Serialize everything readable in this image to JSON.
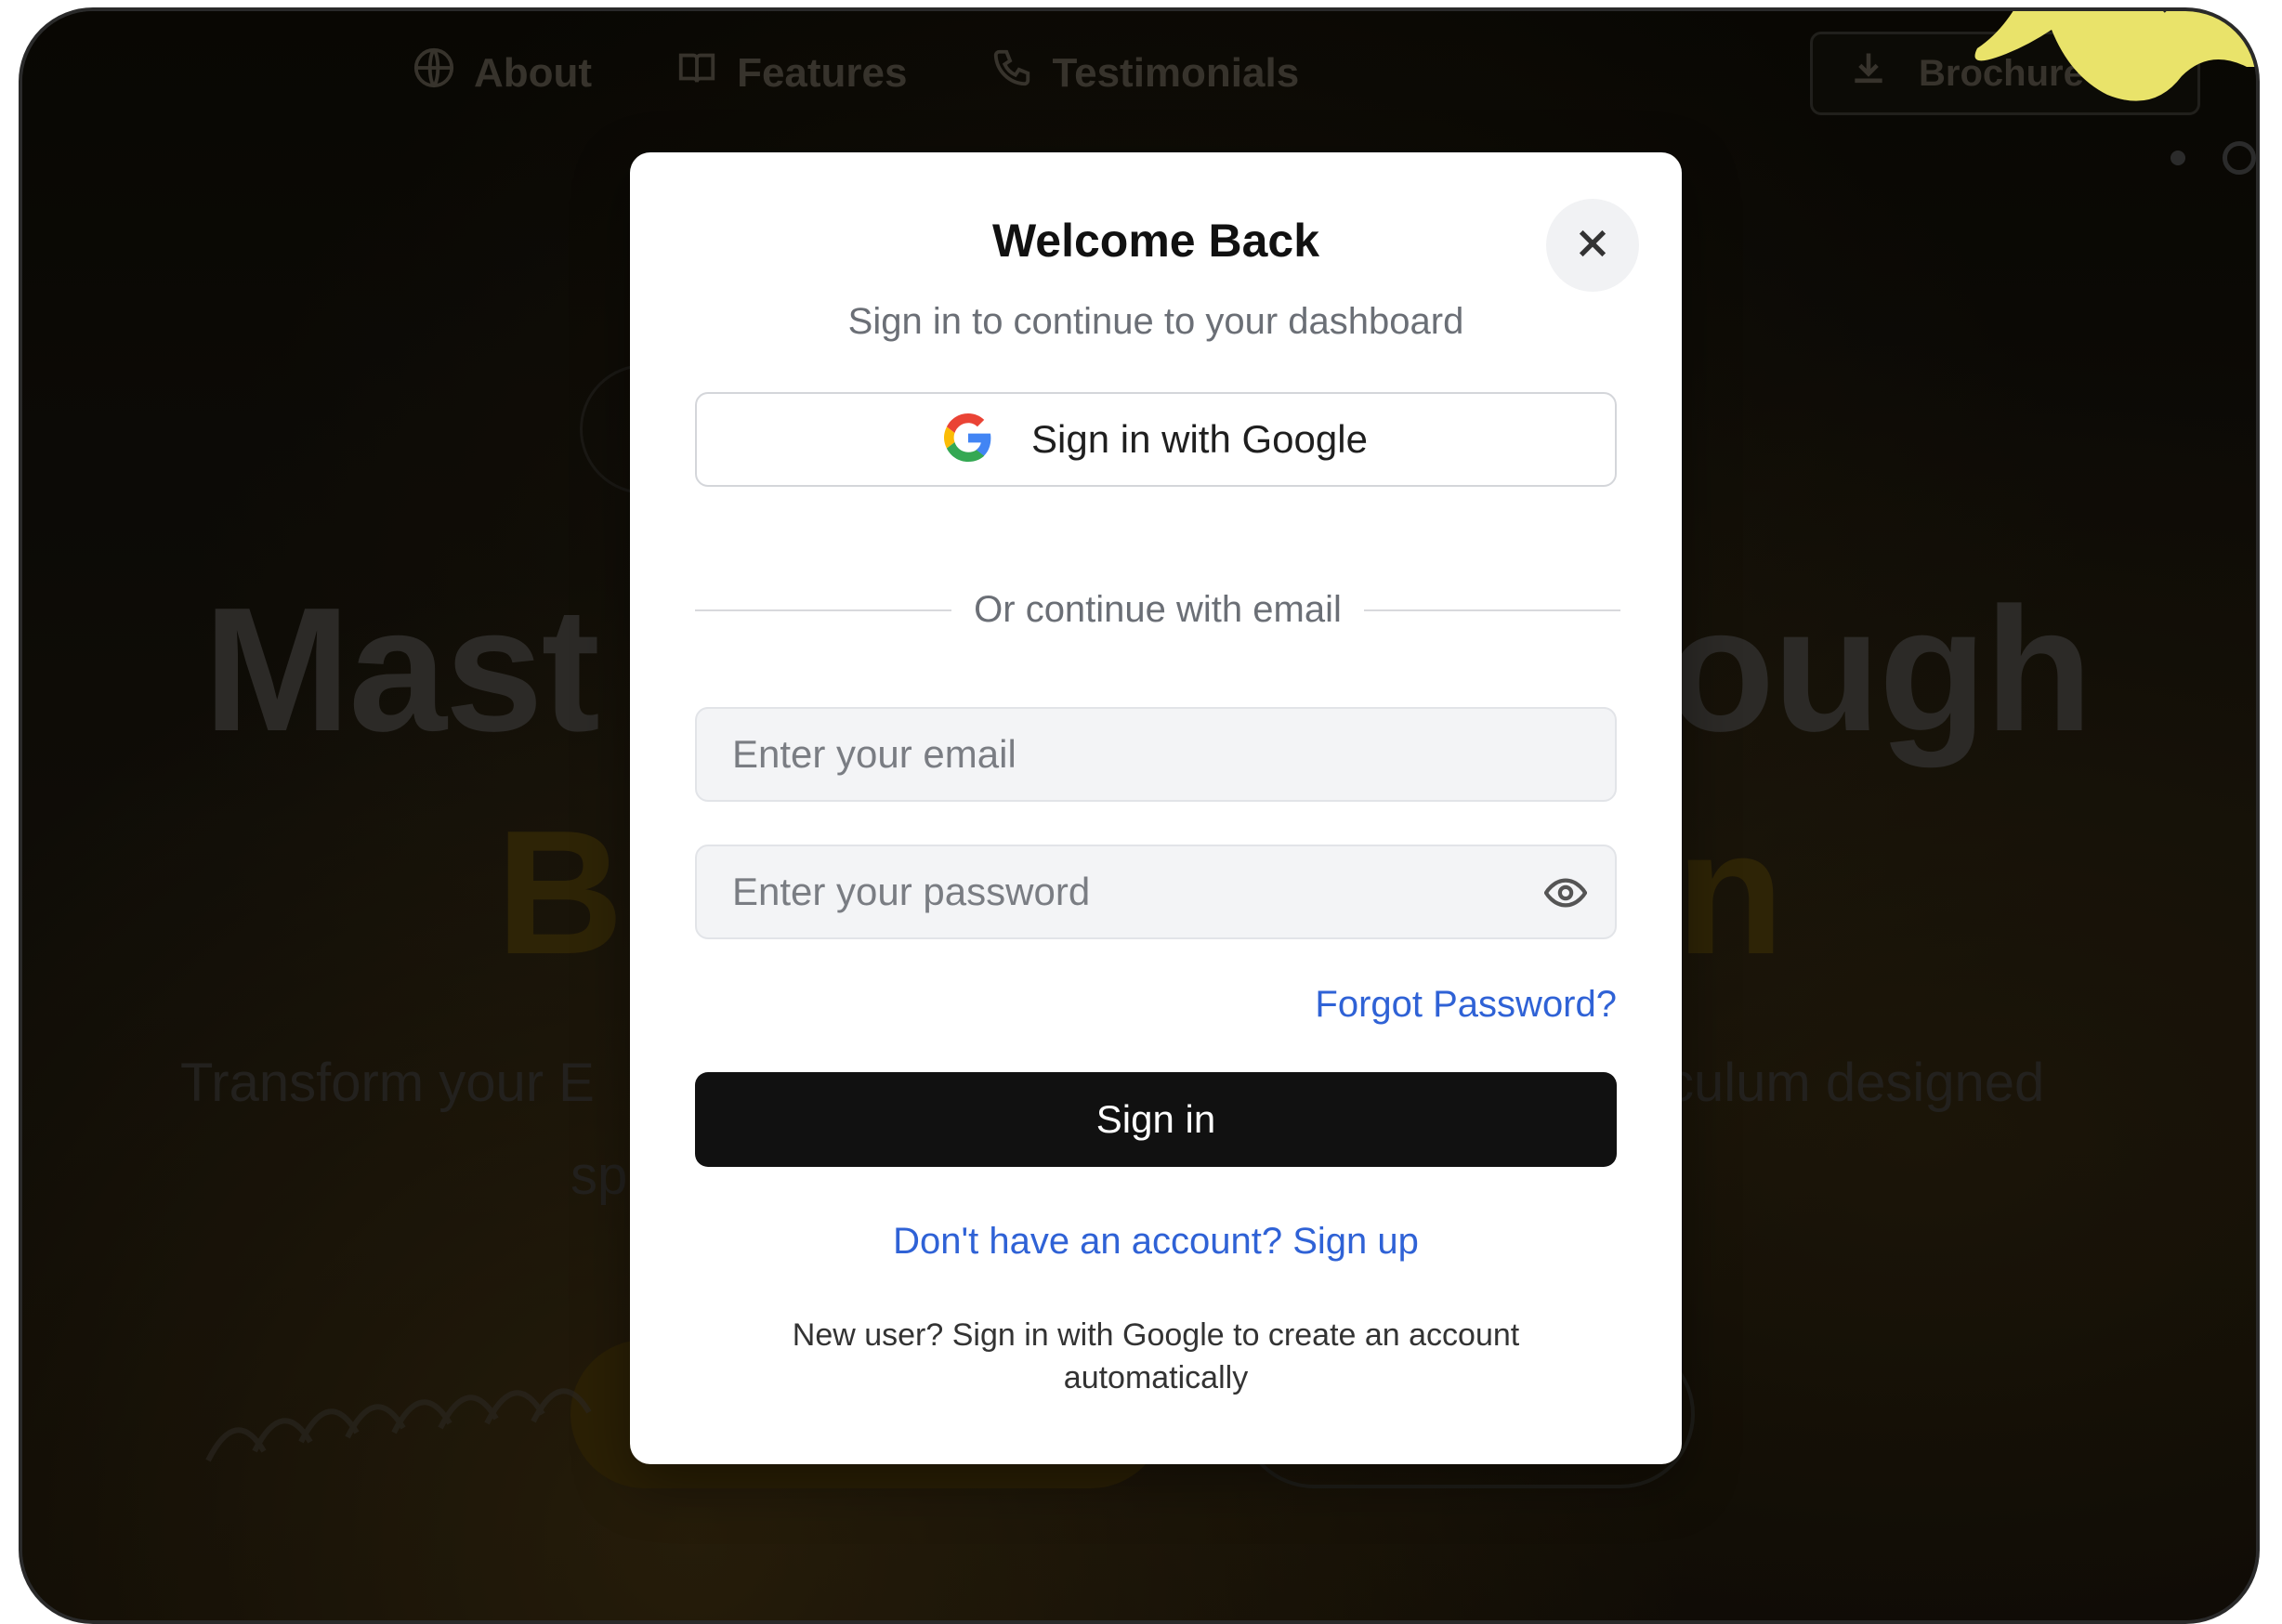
{
  "nav": {
    "items": [
      {
        "label": "About",
        "icon": "globe-icon"
      },
      {
        "label": "Features",
        "icon": "book-icon"
      },
      {
        "label": "Testimonials",
        "icon": "phone-icon"
      }
    ],
    "brochure_label": "Brochure"
  },
  "hero": {
    "title_line1_left": "Mast",
    "title_line1_right": "ough",
    "title_line2_left": "Bi",
    "title_line2_right": "n",
    "subtitle_left": "Transform your E",
    "subtitle_right": "culum designed",
    "subtitle_line2": "sp"
  },
  "modal": {
    "title": "Welcome Back",
    "subtitle": "Sign in to continue to your dashboard",
    "google_button": "Sign in with Google",
    "divider_text": "Or continue with email",
    "email_placeholder": "Enter your email",
    "password_placeholder": "Enter your password",
    "forgot_password": "Forgot Password?",
    "sign_in_button": "Sign in",
    "signup_link": "Don't have an account? Sign up",
    "note": "New user? Sign in with Google to create an account automatically"
  },
  "colors": {
    "accent_link": "#2f62d6",
    "primary_button": "#111111",
    "brand_yellow": "#e9e36a"
  }
}
